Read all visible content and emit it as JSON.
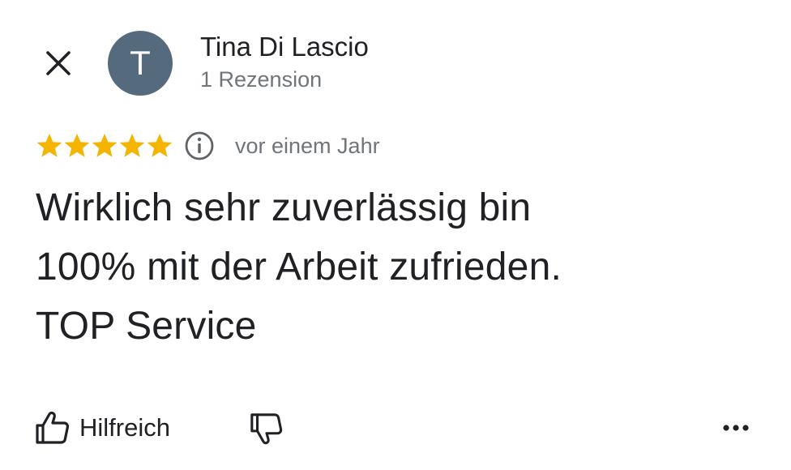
{
  "reviewer": {
    "avatar_initial": "T",
    "name": "Tina Di Lascio",
    "review_count": "1 Rezension"
  },
  "review": {
    "rating": 5,
    "max_rating": 5,
    "date": "vor einem Jahr",
    "text_lines": [
      "Wirklich sehr zuverlässig bin",
      "100% mit der Arbeit zufrieden.",
      "TOP Service"
    ]
  },
  "actions": {
    "helpful_label": "Hilfreich"
  },
  "icons": {
    "close": "close-icon",
    "info": "info-icon",
    "thumbs_up": "thumbs-up-icon",
    "thumbs_down": "thumbs-down-icon",
    "more": "more-horizontal-icon",
    "star": "star-icon"
  },
  "colors": {
    "star": "#f4b400",
    "avatar_bg": "#566a7d",
    "text_primary": "#202124",
    "text_secondary": "#70757a"
  }
}
